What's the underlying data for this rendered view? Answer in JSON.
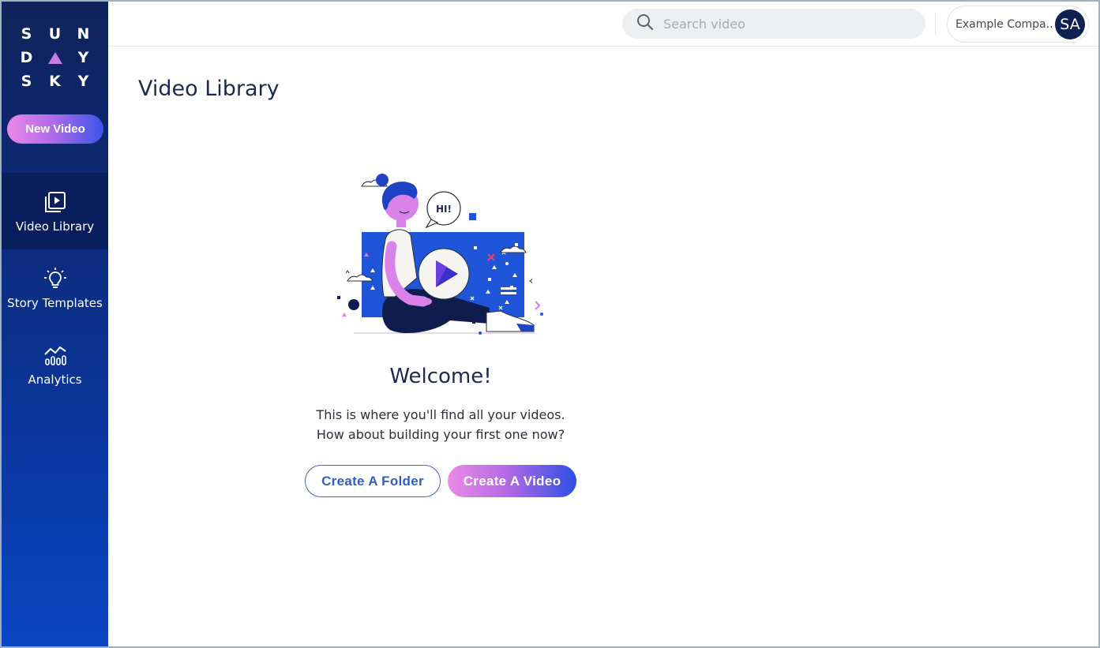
{
  "sidebar": {
    "logo": {
      "row1": [
        "S",
        "U",
        "N"
      ],
      "row2": [
        "D",
        "Y"
      ],
      "row3": [
        "S",
        "K",
        "Y"
      ]
    },
    "new_video_label": "New Video",
    "nav": [
      {
        "label": "Video Library",
        "icon": "video-library-icon",
        "active": true
      },
      {
        "label": "Story Templates",
        "icon": "lightbulb-icon",
        "active": false
      },
      {
        "label": "Analytics",
        "icon": "analytics-icon",
        "active": false
      }
    ]
  },
  "header": {
    "search": {
      "placeholder": "Search video",
      "icon": "search-icon"
    },
    "account": {
      "company": "Example Compa...",
      "avatar_initials": "SA"
    }
  },
  "main": {
    "title": "Video Library",
    "empty_state": {
      "speech_bubble": "HI!",
      "heading": "Welcome!",
      "line1": "This is where you'll find all your videos.",
      "line2": "How about building your first one now?",
      "create_folder_label": "Create A Folder",
      "create_video_label": "Create A Video"
    }
  },
  "colors": {
    "sidebar_top": "#10235a",
    "sidebar_bottom": "#0b46c4",
    "accent_pink": "#ea8ae6",
    "accent_blue": "#2d4fe6",
    "text_dark": "#1d2a4d"
  }
}
